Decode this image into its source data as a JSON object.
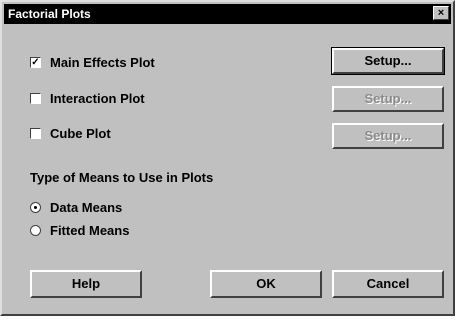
{
  "window": {
    "title": "Factorial Plots",
    "close_glyph": "×"
  },
  "plots": [
    {
      "label": "Main Effects Plot",
      "checked": true,
      "setup_label": "Setup...",
      "setup_enabled": true
    },
    {
      "label": "Interaction Plot",
      "checked": false,
      "setup_label": "Setup...",
      "setup_enabled": false
    },
    {
      "label": "Cube Plot",
      "checked": false,
      "setup_label": "Setup...",
      "setup_enabled": false
    }
  ],
  "means": {
    "section_label": "Type of Means to Use in Plots",
    "options": [
      {
        "label": "Data Means",
        "selected": true
      },
      {
        "label": "Fitted Means",
        "selected": false
      }
    ]
  },
  "buttons": {
    "help": "Help",
    "ok": "OK",
    "cancel": "Cancel"
  },
  "check_glyph": "✓",
  "colors": {
    "titlebar": "#000000",
    "face": "#c0c0c0",
    "disabled_text": "#8a8a8a"
  }
}
